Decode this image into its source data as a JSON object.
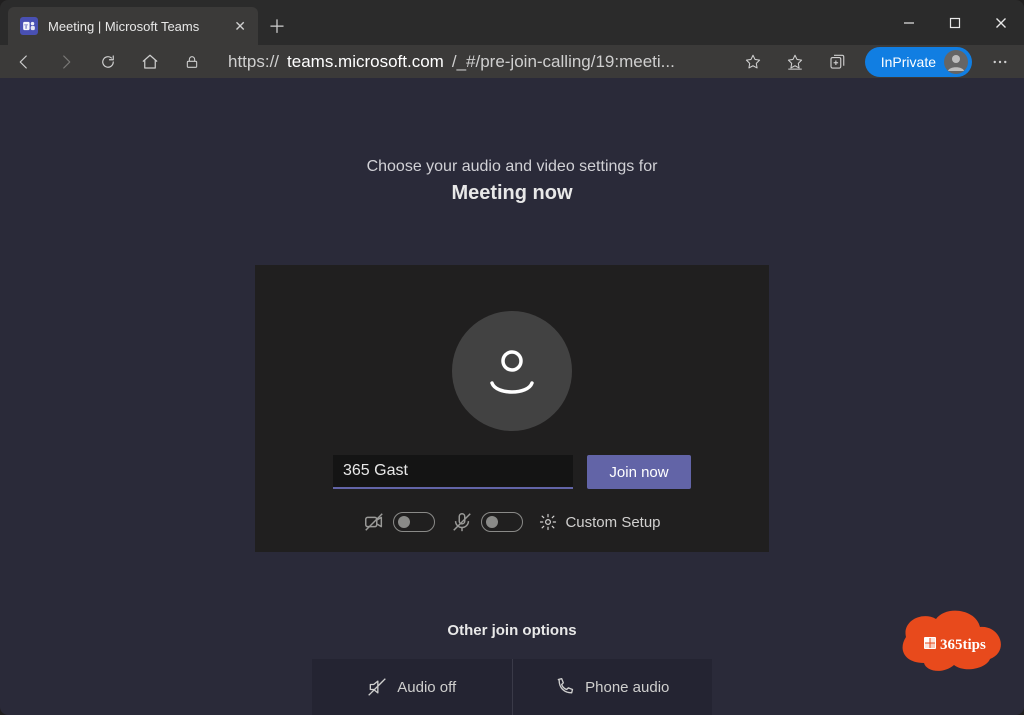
{
  "window": {
    "tab_title": "Meeting | Microsoft Teams"
  },
  "browser": {
    "url_display_prefix": "https://",
    "url_display_host": "teams.microsoft.com",
    "url_display_path": "/_#/pre-join-calling/19:meeti...",
    "inprivate_label": "InPrivate"
  },
  "prejoin": {
    "prompt_sub": "Choose your audio and video settings for",
    "prompt_title": "Meeting now",
    "name_value": "365 Gast",
    "join_label": "Join now",
    "custom_setup_label": "Custom Setup",
    "other_label": "Other join options",
    "audio_off_label": "Audio off",
    "phone_audio_label": "Phone audio"
  },
  "badge": {
    "brand": "365tips"
  }
}
